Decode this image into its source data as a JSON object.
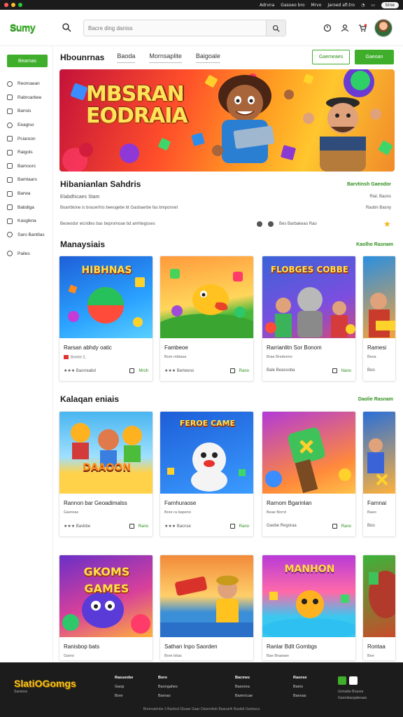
{
  "os": {
    "items": [
      "Adrvna",
      "Gasoeo bro",
      "Mrvo",
      "Jaroed afi:tro"
    ],
    "pill": "bine"
  },
  "header": {
    "logo": "Sumy",
    "search_placeholder": "Bacre ding daniss"
  },
  "sidebar": {
    "button": "Bearnas",
    "items": [
      "Reomaean",
      "Rabroarbee",
      "Bansis",
      "Eeagiso",
      "Pciaroon",
      "Raigols",
      "Bamoors",
      "Bamtaars",
      "Barwa",
      "Babdiga",
      "Kasgikna",
      "Saro Bantilas"
    ],
    "extra": "Pailes"
  },
  "main": {
    "title": "Hbounrnas",
    "tabs": [
      "Baoda",
      "Mornsaplite",
      "Baigoale"
    ],
    "btn_outline": "Gaemeaes",
    "btn_green": "Gaeoan"
  },
  "hero": {
    "line1": "MBSRAN",
    "line2": "EODRAIA"
  },
  "info": {
    "title": "Hibanianlan Sahdris",
    "subtitle": "Elabdhicaes Stam",
    "desc": "Boarrblone is bracerrhis beeogebe bt Gasbaerbe fas bmponnet",
    "meta": "Beoeodor eicridles bas bepromoae bd amhtegoses",
    "right1": "Barvtinsh Gaeodor",
    "right2": "Rial, Baons",
    "right3": "Raobn Basny",
    "icon_text": "Bes  Barbakeao  Rao"
  },
  "sections": [
    {
      "title": "Manaysiais",
      "link": "Kaolho Rasnam",
      "cards": [
        {
          "title": "Rarsan abhdy oatic",
          "meta": "Bomte 2,",
          "stars": "★★★ Baorreabd",
          "act": "Mroh",
          "img_text": "HIBHNAS"
        },
        {
          "title": "Fambeoe",
          "meta": "Bore mbtasa",
          "stars": "★★★ Berteeno",
          "act": "Rano",
          "img_text": ""
        },
        {
          "title": "Rarrianlitn Sor Bonom",
          "meta": "Brae Bnnbomn",
          "stars": "Bale Beassoba",
          "act": "Nano",
          "img_text": "FLOBGES COBBE"
        },
        {
          "title": "Ramesi",
          "meta": "Besa",
          "stars": "Boo",
          "act": "",
          "img_text": ""
        }
      ]
    },
    {
      "title": "Kalaqan eniais",
      "link": "Daolie Rasnam",
      "cards": [
        {
          "title": "Rannon bar Geoadimalss",
          "meta": "Gaoreas",
          "stars": "★★★ Bavbbe",
          "act": "Rano",
          "img_text": "DAAOON"
        },
        {
          "title": "Farnhuraose",
          "meta": "Bore ra bapeno",
          "stars": "★★★ Bacnse",
          "act": "Rano",
          "img_text": "FEROE CAME"
        },
        {
          "title": "Rarnom Bgarinlan",
          "meta": "Beae Borrd",
          "stars": "Gaobe Regoraa",
          "act": "Rano",
          "img_text": ""
        },
        {
          "title": "Farnnai",
          "meta": "Baeo",
          "stars": "Boo",
          "act": "",
          "img_text": ""
        }
      ]
    },
    {
      "title": "",
      "link": "",
      "cards": [
        {
          "title": "Ranisbop bats",
          "meta": "Gamo",
          "stars": "",
          "act": "",
          "img_text": "GKOMS GAMES"
        },
        {
          "title": "Sathan Inpo Saorden",
          "meta": "Bore bitas",
          "stars": "",
          "act": "",
          "img_text": ""
        },
        {
          "title": "Ranlar Bdlt Gombgs",
          "meta": "Bae Bnaeare",
          "stars": "",
          "act": "",
          "img_text": "MANHON"
        },
        {
          "title": "Rontaa",
          "meta": "Bee",
          "stars": "",
          "act": "",
          "img_text": ""
        }
      ]
    }
  ],
  "footer": {
    "logo": "SlatiOGomgs",
    "logo_sub": "Sarwoss",
    "col1": [
      "Rasueobe",
      "Gaop",
      "Bore"
    ],
    "col2": [
      "Boro",
      "Baongahes",
      "Barnao"
    ],
    "col3": [
      "Bacmes",
      "Baeorea",
      "Bamrocae"
    ],
    "col4": [
      "Rasnse",
      "Baino",
      "Baeoas"
    ],
    "right_text": [
      "Grmwbe Braoee",
      "Gaombaegabeaas"
    ],
    "copy": "Borenatenbe 3 Baobcd Gbaae Gaac Daisonbob Baaraelh Baaibd Gaobaca"
  },
  "colors": {
    "brand": "#3fae2a",
    "footer": "#1c1c1c",
    "star": "#f3b51c"
  },
  "icons": [
    "search-icon",
    "clock-icon",
    "user-icon",
    "cart-icon",
    "star-icon"
  ]
}
